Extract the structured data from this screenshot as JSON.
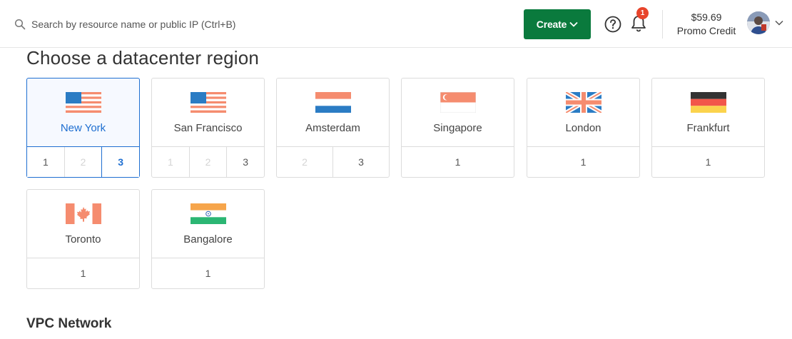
{
  "search": {
    "placeholder": "Search by resource name or public IP (Ctrl+B)"
  },
  "header": {
    "create_label": "Create",
    "notifications_count": "1",
    "credit_amount": "$59.69",
    "credit_label": "Promo Credit"
  },
  "page": {
    "title": "Choose a datacenter region",
    "vpc_title": "VPC Network"
  },
  "regions": [
    {
      "name": "New York",
      "selected": true,
      "datacenters": [
        {
          "label": "1",
          "state": "normal"
        },
        {
          "label": "2",
          "state": "disabled"
        },
        {
          "label": "3",
          "state": "active"
        }
      ]
    },
    {
      "name": "San Francisco",
      "selected": false,
      "datacenters": [
        {
          "label": "1",
          "state": "disabled"
        },
        {
          "label": "2",
          "state": "disabled"
        },
        {
          "label": "3",
          "state": "normal"
        }
      ]
    },
    {
      "name": "Amsterdam",
      "selected": false,
      "datacenters": [
        {
          "label": "2",
          "state": "disabled"
        },
        {
          "label": "3",
          "state": "normal"
        }
      ]
    },
    {
      "name": "Singapore",
      "selected": false,
      "datacenters": [
        {
          "label": "1",
          "state": "normal"
        }
      ]
    },
    {
      "name": "London",
      "selected": false,
      "datacenters": [
        {
          "label": "1",
          "state": "normal"
        }
      ]
    },
    {
      "name": "Frankfurt",
      "selected": false,
      "datacenters": [
        {
          "label": "1",
          "state": "normal"
        }
      ]
    },
    {
      "name": "Toronto",
      "selected": false,
      "datacenters": [
        {
          "label": "1",
          "state": "normal"
        }
      ]
    },
    {
      "name": "Bangalore",
      "selected": false,
      "datacenters": [
        {
          "label": "1",
          "state": "normal"
        }
      ]
    }
  ],
  "colors": {
    "accent": "#1f6fd1",
    "create_button": "#0a7a3d",
    "badge": "#e8442b"
  },
  "icons": [
    "search-icon",
    "chevron-down-icon",
    "help-icon",
    "bell-icon",
    "avatar"
  ]
}
